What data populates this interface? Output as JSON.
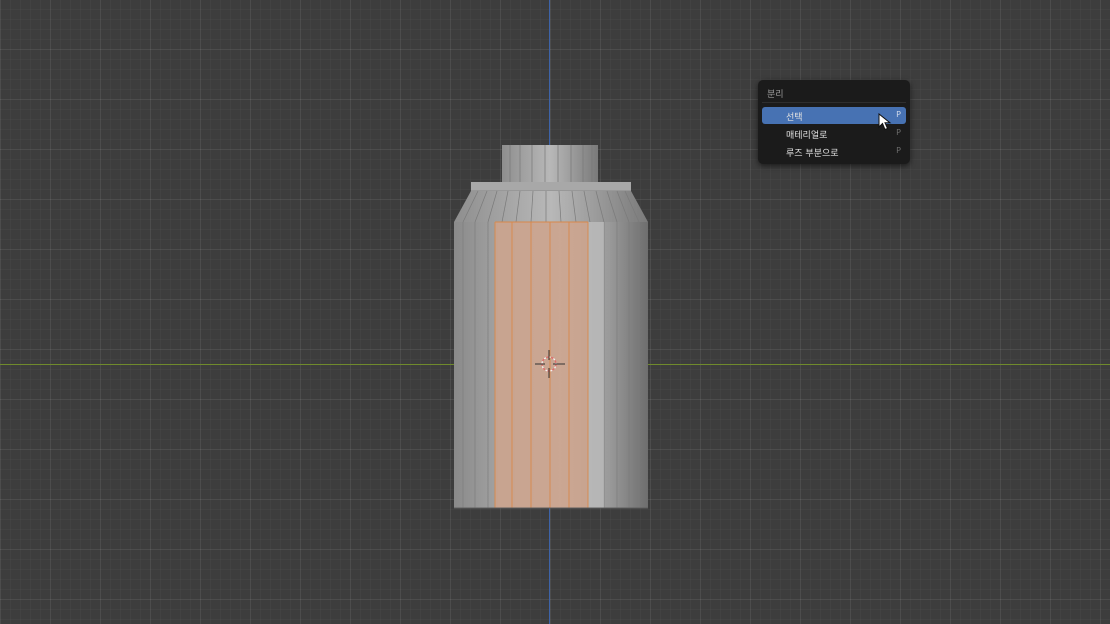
{
  "viewport": {
    "colors": {
      "background": "#3d3d3d",
      "axis_x": "#6f8a2c",
      "axis_y": "#3d63a8",
      "selection": "#e89a5c"
    },
    "object": "cylinder-bottle-mesh",
    "cursor": "3d-cursor-icon"
  },
  "menu": {
    "title": "분리",
    "items": [
      {
        "label": "선택",
        "shortcut": "P",
        "active": true
      },
      {
        "label": "매테리얼로",
        "shortcut": "P",
        "active": false
      },
      {
        "label": "루즈 부분으로",
        "shortcut": "P",
        "active": false
      }
    ],
    "accent": "#4772b3"
  },
  "pointer": "mouse-pointer-icon"
}
